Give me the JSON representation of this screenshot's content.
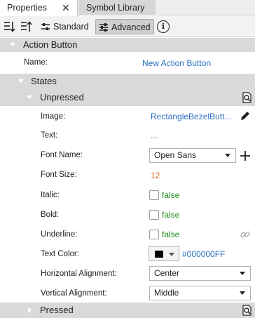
{
  "tabs": [
    {
      "label": "Properties",
      "close": "✕"
    },
    {
      "label": "Symbol Library"
    }
  ],
  "toolbar": {
    "standard_label": "Standard",
    "advanced_label": "Advanced",
    "info_label": "i"
  },
  "section": {
    "title": "Action Button",
    "name_label": "Name:",
    "name_value": "New Action Button"
  },
  "states": {
    "title": "States",
    "unpressed": {
      "title": "Unpressed",
      "fields": {
        "image_label": "Image:",
        "image_value": "RectangleBezelButt...",
        "text_label": "Text:",
        "text_value": "...",
        "font_name_label": "Font Name:",
        "font_name_value": "Open Sans",
        "font_size_label": "Font Size:",
        "font_size_value": "12",
        "italic_label": "Italic:",
        "italic_value": "false",
        "bold_label": "Bold:",
        "bold_value": "false",
        "underline_label": "Underline:",
        "underline_value": "false",
        "text_color_label": "Text Color:",
        "text_color_value": "#000000FF",
        "halign_label": "Horizontal Alignment:",
        "halign_value": "Center",
        "valign_label": "Vertical Alignment:",
        "valign_value": "Middle"
      }
    },
    "pressed": {
      "title": "Pressed"
    }
  },
  "colors": {
    "link": "#2a6fc0",
    "number": "#e06a1c",
    "boolean": "#1c8a1c",
    "header_bg": "#d9d9d9",
    "swatch": "#000000"
  }
}
